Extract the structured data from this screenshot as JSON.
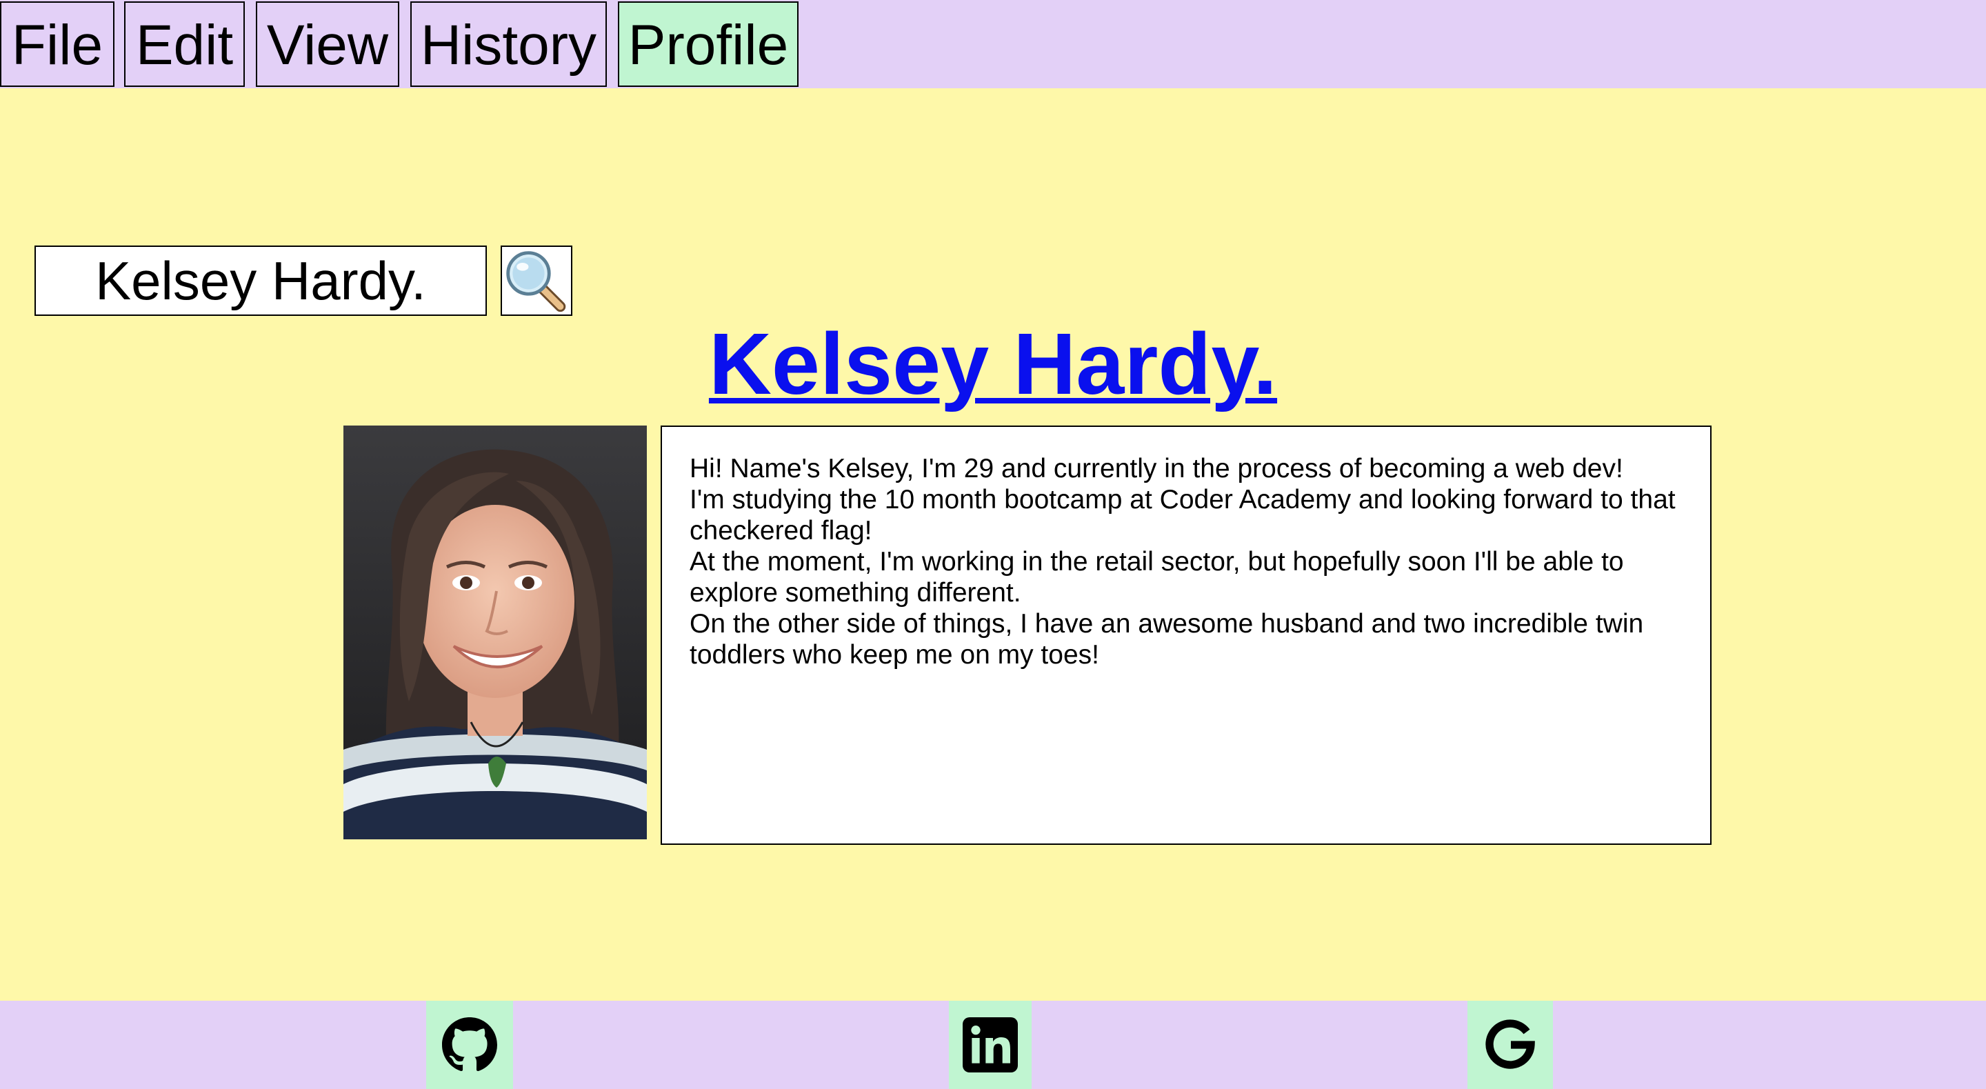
{
  "menu": {
    "items": [
      {
        "label": "File"
      },
      {
        "label": "Edit"
      },
      {
        "label": "View"
      },
      {
        "label": "History"
      },
      {
        "label": "Profile"
      }
    ],
    "active": "Profile"
  },
  "search": {
    "value": "Kelsey Hardy.",
    "icon": "magnifier-icon"
  },
  "profile": {
    "name": "Kelsey Hardy.",
    "avatar": "profile-photo",
    "bio": [
      "Hi! Name's Kelsey, I'm 29 and currently in the process of becoming a web dev!",
      "I'm studying the 10 month bootcamp at Coder Academy and looking forward to that checkered flag!",
      "At the moment, I'm working in the retail sector, but hopefully soon I'll be able to explore something different.",
      "On the other side of things, I have an awesome husband and two incredible twin toddlers who keep me on my toes!"
    ]
  },
  "footer": {
    "links": [
      {
        "icon": "github-icon"
      },
      {
        "icon": "linkedin-icon"
      },
      {
        "icon": "google-icon"
      }
    ]
  },
  "colors": {
    "page_bg": "#fef8a9",
    "bar_bg": "#e3d0f7",
    "accent_green": "#c0f5d1",
    "link_blue": "#0a10ee"
  }
}
